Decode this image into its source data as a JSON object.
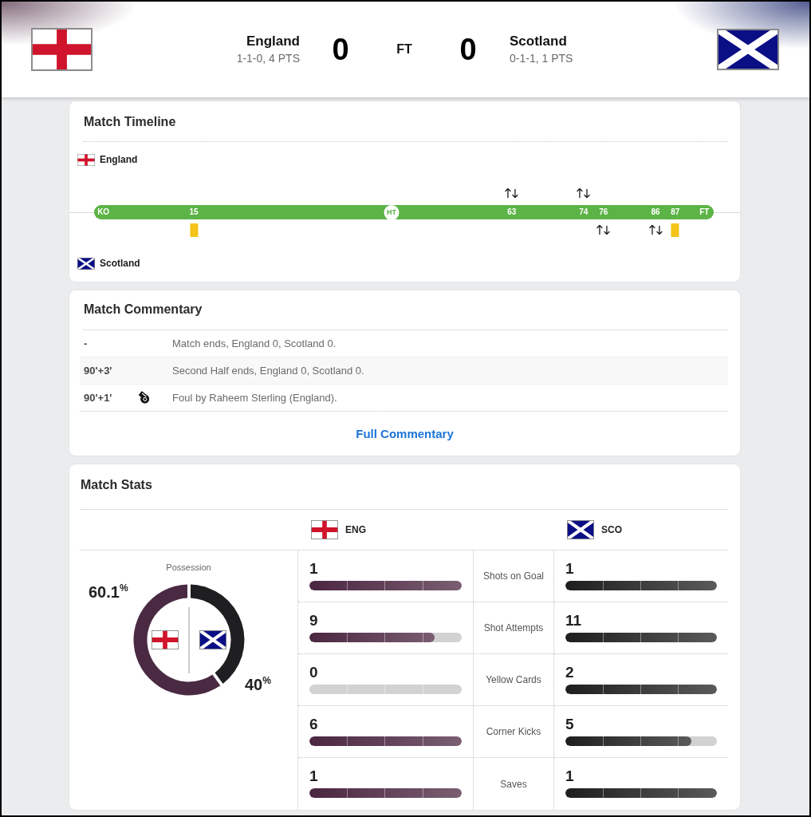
{
  "scoreboard": {
    "home": {
      "name": "England",
      "record": "1-1-0, 4 PTS",
      "score": "0"
    },
    "status": "FT",
    "away": {
      "name": "Scotland",
      "record": "0-1-1, 1 PTS",
      "score": "0"
    }
  },
  "timeline": {
    "title": "Match Timeline",
    "home_team": "England",
    "away_team": "Scotland",
    "markers": [
      {
        "label": "KO",
        "kind": "tick"
      },
      {
        "label": "15",
        "kind": "tick",
        "away_events": [
          {
            "kind": "yellow_card"
          }
        ]
      },
      {
        "label": "HT",
        "kind": "halftime"
      },
      {
        "label": "63",
        "kind": "tick",
        "home_events": [
          {
            "kind": "substitution"
          }
        ]
      },
      {
        "label": "74",
        "kind": "tick",
        "home_events": [
          {
            "kind": "substitution"
          }
        ]
      },
      {
        "label": "76",
        "kind": "tick",
        "away_events": [
          {
            "kind": "substitution"
          }
        ]
      },
      {
        "label": "86",
        "kind": "tick",
        "away_events": [
          {
            "kind": "substitution"
          }
        ]
      },
      {
        "label": "87",
        "kind": "tick",
        "away_events": [
          {
            "kind": "yellow_card"
          }
        ]
      },
      {
        "label": "FT",
        "kind": "tick"
      }
    ]
  },
  "commentary": {
    "title": "Match Commentary",
    "rows": [
      {
        "time": "-",
        "kind": "note",
        "text": "Match ends, England 0, Scotland 0."
      },
      {
        "time": "90'+3'",
        "kind": "note",
        "text": "Second Half ends, England 0, Scotland 0."
      },
      {
        "time": "90'+1'",
        "kind": "foul",
        "text": "Foul by Raheem Sterling (England)."
      }
    ],
    "link": "Full Commentary"
  },
  "stats": {
    "title": "Match Stats",
    "home_team": "ENG",
    "away_team": "SCO",
    "possession": {
      "chart_data": {
        "type": "donut",
        "title": "Possession",
        "values": [
          60.1,
          40
        ],
        "colors": [
          "#4a2a42",
          "#1f1f21"
        ],
        "value_labels": [
          "60.1$^{%}$",
          "40$^{%}$"
        ]
      }
    },
    "rows": [
      {
        "label": "Shots on Goal",
        "home": {
          "value": "1",
          "level": 1
        },
        "away": {
          "value": "1",
          "level": 1
        }
      },
      {
        "label": "Shot Attempts",
        "home": {
          "value": "9",
          "level": 0.82
        },
        "away": {
          "value": "11",
          "level": 1
        }
      },
      {
        "label": "Yellow Cards",
        "home": {
          "value": "0",
          "level": 0
        },
        "away": {
          "value": "2",
          "level": 1
        }
      },
      {
        "label": "Corner Kicks",
        "home": {
          "value": "6",
          "level": 1
        },
        "away": {
          "value": "5",
          "level": 0.83
        }
      },
      {
        "label": "Saves",
        "home": {
          "value": "1",
          "level": 1
        },
        "away": {
          "value": "1",
          "level": 1
        }
      }
    ]
  }
}
